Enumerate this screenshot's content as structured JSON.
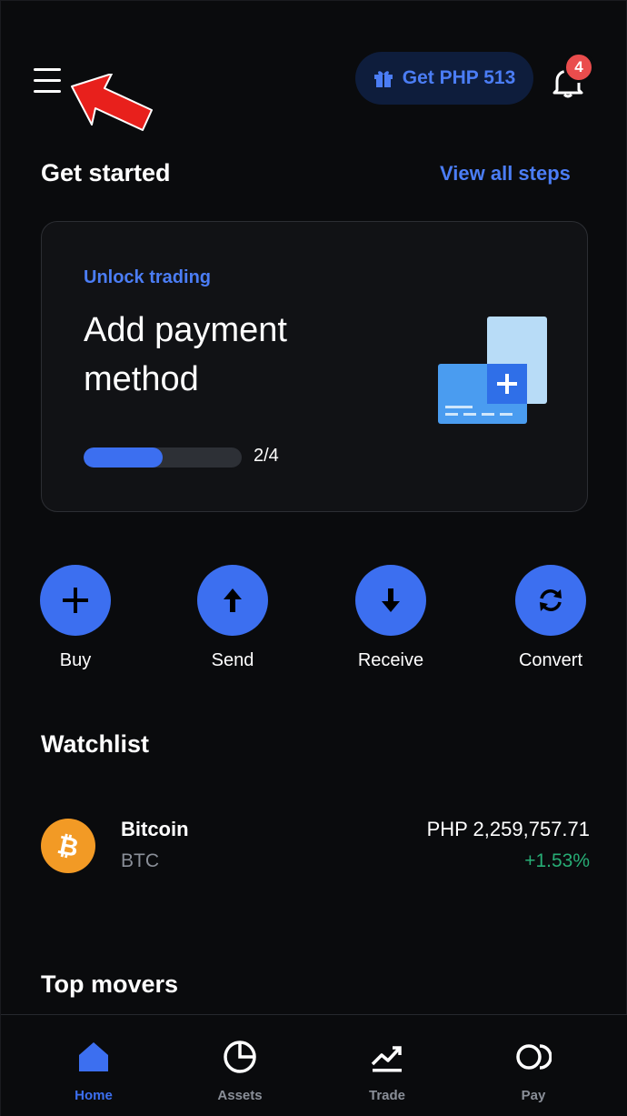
{
  "header": {
    "promo_label": "Get PHP 513",
    "notification_count": "4"
  },
  "get_started": {
    "title": "Get started",
    "view_all": "View all steps",
    "card": {
      "eyebrow": "Unlock trading",
      "headline": "Add payment method",
      "progress_fraction": 0.5,
      "progress_text": "2/4"
    }
  },
  "actions": [
    {
      "label": "Buy",
      "icon": "plus-icon"
    },
    {
      "label": "Send",
      "icon": "arrow-up-icon"
    },
    {
      "label": "Receive",
      "icon": "arrow-down-icon"
    },
    {
      "label": "Convert",
      "icon": "convert-icon"
    }
  ],
  "watchlist": {
    "title": "Watchlist",
    "items": [
      {
        "name": "Bitcoin",
        "symbol": "BTC",
        "price": "PHP 2,259,757.71",
        "change": "+1.53%"
      }
    ]
  },
  "top_movers": {
    "title": "Top movers"
  },
  "nav": [
    {
      "label": "Home",
      "icon": "home-icon",
      "active": true
    },
    {
      "label": "Assets",
      "icon": "pie-chart-icon",
      "active": false
    },
    {
      "label": "Trade",
      "icon": "trade-chart-icon",
      "active": false
    },
    {
      "label": "Pay",
      "icon": "pay-icon",
      "active": false
    }
  ],
  "colors": {
    "accent": "#3c6ff0",
    "link": "#4b7df5",
    "positive": "#27ad75",
    "badge": "#ea4d4d",
    "bitcoin": "#f29a25"
  }
}
